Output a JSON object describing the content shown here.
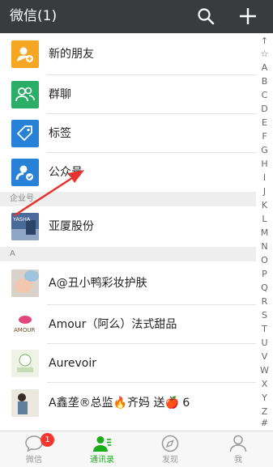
{
  "header": {
    "title": "微信(1)",
    "search_icon": "search-icon",
    "add_icon": "plus-icon"
  },
  "functions": [
    {
      "label": "新的朋友",
      "icon": "new-friends-icon",
      "color": "#f5a623"
    },
    {
      "label": "群聊",
      "icon": "group-chat-icon",
      "color": "#2aae67"
    },
    {
      "label": "标签",
      "icon": "tag-icon",
      "color": "#2782d7"
    },
    {
      "label": "公众号",
      "icon": "official-account-icon",
      "color": "#2782d7"
    }
  ],
  "sections": {
    "enterprise": "企业号",
    "a": "A"
  },
  "enterprise_items": [
    {
      "label": "亚厦股份",
      "avatar_text": "YASHA"
    }
  ],
  "contacts": [
    {
      "label": "A@丑小鸭彩妆护肤"
    },
    {
      "label": "Amour（阿么）法式甜品",
      "avatar_text": "AMOUR"
    },
    {
      "label": "Aurevoir"
    },
    {
      "label": "A鑫垄®总监🔥齐妈 送🍎 6"
    }
  ],
  "index": [
    "↑",
    "☆",
    "A",
    "B",
    "C",
    "D",
    "E",
    "F",
    "G",
    "H",
    "I",
    "J",
    "K",
    "L",
    "M",
    "N",
    "O",
    "P",
    "Q",
    "R",
    "S",
    "T",
    "U",
    "V",
    "W",
    "X",
    "Y",
    "Z",
    "#"
  ],
  "tabbar": {
    "tabs": [
      {
        "label": "微信",
        "icon": "chat-bubble-icon",
        "badge": "1"
      },
      {
        "label": "通讯录",
        "icon": "contacts-icon"
      },
      {
        "label": "发现",
        "icon": "compass-icon"
      },
      {
        "label": "我",
        "icon": "person-icon"
      }
    ]
  },
  "colors": {
    "header_bg": "#3a3b3f",
    "active_green": "#1aad19",
    "badge_red": "#f43530",
    "arrow_red": "#e8322c"
  }
}
